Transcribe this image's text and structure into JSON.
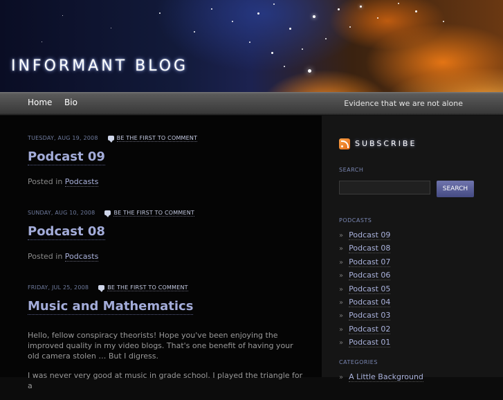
{
  "header": {
    "site_title": "INFORMANT BLOG"
  },
  "nav": {
    "items": [
      "Home",
      "Bio"
    ],
    "tagline": "Evidence that we are not alone"
  },
  "posts": [
    {
      "date": "TUESDAY, AUG 19, 2008",
      "comment_link": "BE THE FIRST TO COMMENT",
      "title": "Podcast 09",
      "posted_in_label": "Posted in",
      "category": "Podcasts"
    },
    {
      "date": "SUNDAY, AUG 10, 2008",
      "comment_link": "BE THE FIRST TO COMMENT",
      "title": "Podcast 08",
      "posted_in_label": "Posted in",
      "category": "Podcasts"
    },
    {
      "date": "FRIDAY, JUL 25, 2008",
      "comment_link": "BE THE FIRST TO COMMENT",
      "title": "Music and Mathematics",
      "body": [
        "Hello, fellow conspiracy theorists! Hope you've been enjoying the improved quality in my video blogs. That's one benefit of having your old camera stolen … But I digress.",
        "I was never very good at music in grade school. I played the triangle for a"
      ]
    }
  ],
  "sidebar": {
    "subscribe_label": "SUBSCRIBE",
    "search": {
      "title": "SEARCH",
      "button_label": "SEARCH",
      "value": ""
    },
    "podcasts": {
      "title": "PODCASTS",
      "items": [
        "Podcast 09",
        "Podcast 08",
        "Podcast 07",
        "Podcast 06",
        "Podcast 05",
        "Podcast 04",
        "Podcast 03",
        "Podcast 02",
        "Podcast 01"
      ]
    },
    "categories": {
      "title": "CATEGORIES",
      "items": [
        "A Little Background"
      ]
    }
  },
  "colors": {
    "background": "#0c0c0c",
    "sidebar": "#151515",
    "link": "#aab2dc",
    "title": "#a3acd9",
    "meta": "#6f7b9e",
    "button": "#5a5f9a"
  }
}
